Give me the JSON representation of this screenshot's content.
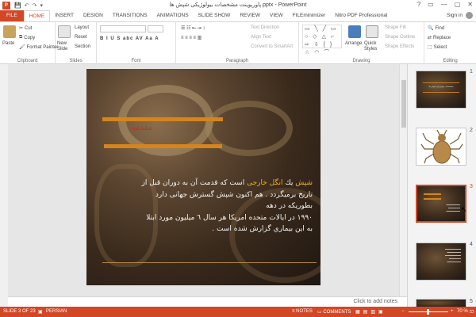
{
  "titlebar": {
    "title": "پاورپوینت مشخصات بیولوژیکی شپش ها.pptx - PowerPoint",
    "app_icon": "P",
    "qat": [
      "💾",
      "↶",
      "↷",
      "▾"
    ],
    "win_buttons": [
      "?",
      "▭",
      "—",
      "▢",
      "✕"
    ]
  },
  "tabs": [
    "FILE",
    "HOME",
    "INSERT",
    "DESIGN",
    "TRANSITIONS",
    "ANIMATIONS",
    "SLIDE SHOW",
    "REVIEW",
    "VIEW",
    "FILEminimizer",
    "Nitro PDF Professional"
  ],
  "signin": "Sign in",
  "ribbon": {
    "clipboard": {
      "paste": "Paste",
      "cut": "Cut",
      "copy": "Copy",
      "format_painter": "Format Painter",
      "label": "Clipboard"
    },
    "slides": {
      "new_slide": "New Slide",
      "layout": "Layout",
      "reset": "Reset",
      "section": "Section",
      "label": "Slides"
    },
    "font": {
      "label": "Font",
      "buttons": "B I U S abc AV Aa A"
    },
    "paragraph": {
      "text_direction": "Text Direction",
      "align_text": "Align Text",
      "convert": "Convert to SmartArt",
      "label": "Paragraph"
    },
    "drawing": {
      "arrange": "Arrange",
      "quick_styles": "Quick Styles",
      "shape_fill": "Shape Fill",
      "shape_outline": "Shape Outline",
      "shape_effects": "Shape Effects",
      "label": "Drawing",
      "shapes": "▭ ╲ ╱ ▭ ○ ◇ △ ⌐ ⇨ ⇩ { } ☆ ◠ ⌒"
    },
    "editing": {
      "find": "Find",
      "replace": "Replace",
      "select": "Select",
      "label": "Editing"
    }
  },
  "slide": {
    "title": "مقدمه",
    "lines": [
      {
        "hl": "شپش",
        "mid": " يك ",
        "hl2": "انگل خارجی",
        "rest": " است كه قدمت آن به دوران قبل از"
      },
      {
        "text": "تاریخ برمیگردد . هم اكنون شپش گسترش جهانی دارد"
      },
      {
        "text": "بطوريكه در دهه"
      },
      {
        "text": "۱۹۹۰ در ايالات متحده امريكا هر سال ٦ ميليون مورد ابتلا"
      },
      {
        "text": "به اين بيماري گزارش شده است ."
      }
    ]
  },
  "thumbnails": [
    {
      "num": "1",
      "title": "مشخصات بیولوژیکی شپش ها"
    },
    {
      "num": "2",
      "title": ""
    },
    {
      "num": "3",
      "title": "مقدمه"
    },
    {
      "num": "4",
      "title": ""
    },
    {
      "num": "5",
      "title": ""
    }
  ],
  "notes_placeholder": "Click to add notes",
  "status": {
    "slide": "SLIDE 3 OF 23",
    "language": "PERSIAN",
    "notes": "NOTES",
    "comments": "COMMENTS",
    "zoom": "70 %"
  }
}
